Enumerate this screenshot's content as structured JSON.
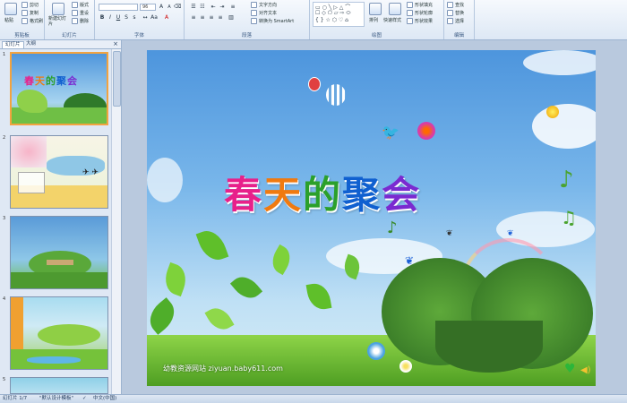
{
  "ribbon": {
    "clipboard": {
      "paste": "粘贴",
      "cut": "剪切",
      "copy": "复制",
      "painter": "格式刷",
      "label": "剪贴板"
    },
    "slides": {
      "new_slide": "新建幻灯片",
      "layout": "版式",
      "reset": "重设",
      "delete": "删除",
      "label": "幻灯片"
    },
    "font": {
      "size": "96",
      "label": "字体"
    },
    "paragraph": {
      "text_direction": "文字方向",
      "align_text": "对齐文本",
      "smartart": "转换为 SmartArt",
      "label": "段落"
    },
    "drawing": {
      "arrange": "排列",
      "quick_styles": "快速样式",
      "shape_fill": "形状填充",
      "shape_outline": "形状轮廓",
      "shape_effects": "形状效果",
      "label": "绘图"
    },
    "editing": {
      "find": "查找",
      "replace": "替换",
      "select": "选择",
      "label": "编辑"
    }
  },
  "panel": {
    "tab_slides": "幻灯片",
    "tab_outline": "大纲",
    "thumb_numbers": [
      "1",
      "2",
      "3",
      "4",
      "5"
    ],
    "thumb_title": "春天的聚会"
  },
  "slide": {
    "title_chars": [
      "春",
      "天",
      "的",
      "聚",
      "会"
    ],
    "title_colors": [
      "#e8208a",
      "#f07a10",
      "#2ba02b",
      "#1060d0",
      "#7a2ad0"
    ],
    "footer": "幼教资源网站  ziyuan.baby611.com"
  },
  "status": {
    "slide_indicator": "幻灯片 1/7",
    "theme": "\"默认设计模板\"",
    "language": "中文(中国)"
  },
  "icons": [
    "paste-icon",
    "cut-icon",
    "copy-icon",
    "format-painter-icon",
    "new-slide-icon",
    "find-icon",
    "replace-icon",
    "select-icon",
    "speaker-icon",
    "heart-icon"
  ]
}
